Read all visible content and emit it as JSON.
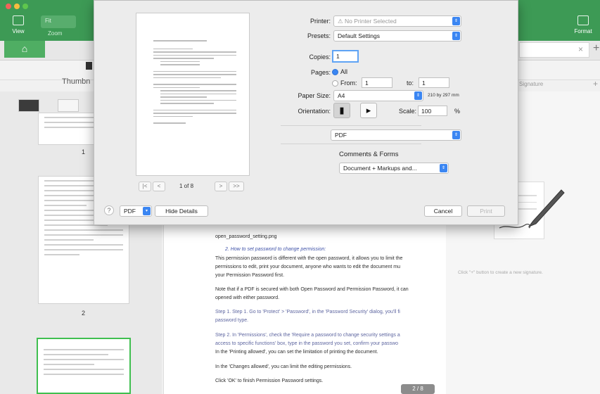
{
  "toolbar": {
    "view_label": "View",
    "zoom_value": "Fit",
    "zoom_label": "Zoom",
    "format_label": "Format"
  },
  "thumbnails": {
    "title": "Thumbn",
    "page_numbers": [
      "1",
      "2"
    ]
  },
  "signature_panel": {
    "title": "Signature",
    "hint": "Click \"+\" button to create a new signature."
  },
  "document": {
    "lines": [
      "open_password_setting.png",
      "2.        How to set password to change permission:",
      "This permission password is different with the open password, it allows you to limit the",
      "permissions to edit, print your document, anyone who wants to edit the document mu",
      "your Permission Password first.",
      "Note that if a PDF is secured with both Open Password and Permission Password, it can",
      "opened with either password.",
      "Step 1. Step 1. Go to 'Protect' > 'Password', in the 'Password Security' dialog, you'll fi",
      "password type.",
      "Step 2. In 'Permissions', check the 'Require a password to change security settings a",
      "access to specific functions' box, type in the password you set, confirm your passwo",
      "In the 'Printing allowed', you can set the limitation of printing the document.",
      "In the 'Changes allowed', you can limit the editing permissions.",
      "Click 'OK' to finish Permission Password settings."
    ],
    "page_indicator": "2 / 8"
  },
  "print_dialog": {
    "printer_label": "Printer:",
    "printer_value": "⚠ No Printer Selected",
    "presets_label": "Presets:",
    "presets_value": "Default Settings",
    "copies_label": "Copies:",
    "copies_value": "1",
    "pages_label": "Pages:",
    "pages_all": "All",
    "pages_from_label": "From:",
    "pages_from_value": "1",
    "pages_to_label": "to:",
    "pages_to_value": "1",
    "paper_size_label": "Paper Size:",
    "paper_size_value": "A4",
    "paper_dimensions": "210 by 297 mm",
    "orientation_label": "Orientation:",
    "scale_label": "Scale:",
    "scale_value": "100",
    "scale_unit": "%",
    "app_section_value": "PDF",
    "comments_forms_label": "Comments & Forms",
    "comments_forms_value": "Document + Markups and...",
    "preview_pager": {
      "first": "|<",
      "prev": "<",
      "page_text": "1 of 8",
      "next": ">",
      "last": ">>"
    },
    "help_label": "?",
    "pdf_button": "PDF",
    "hide_details": "Hide Details",
    "cancel": "Cancel",
    "print": "Print"
  },
  "colors": {
    "toolbar_green": "#3d9a55",
    "accent_blue": "#3b86f2",
    "active_thumb_border": "#3fbf4f"
  }
}
